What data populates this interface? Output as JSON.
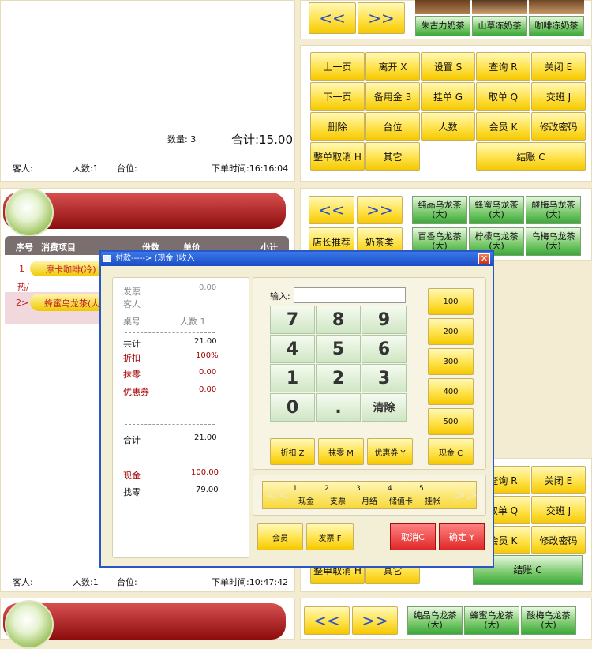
{
  "top_order": {
    "qty_label": "数量: 3",
    "total_label": "合计:15.00",
    "guest_label": "客人:",
    "people_label": "人数:1",
    "table_label": "台位:",
    "time_label": "下单时间:16:16:04"
  },
  "top_right": {
    "prev": "<<",
    "next": ">>",
    "items": [
      "朱古力奶茶",
      "山草冻奶茶",
      "咖啡冻奶茶"
    ]
  },
  "func_buttons": [
    "上一页",
    "离开 X",
    "设置 S",
    "查询 R",
    "关闭 E",
    "下一页",
    "备用金 3",
    "挂单 G",
    "取单 Q",
    "交班 J",
    "删除",
    "台位",
    "人数",
    "会员 K",
    "修改密码",
    "整单取消 H",
    "其它",
    "结账 C"
  ],
  "mid_right": {
    "prev": "<<",
    "next": ">>",
    "cat1": "店长推荐",
    "cat2": "奶茶类",
    "items": [
      "纯品乌龙茶(大)",
      "蜂蜜乌龙茶(大)",
      "酸梅乌龙茶(大)",
      "百香乌龙茶(大)",
      "柠檬乌龙茶(大)",
      "乌梅乌龙茶(大)"
    ]
  },
  "mid_order": {
    "headers": [
      "序号",
      "消费项目",
      "份数",
      "单价",
      "小计"
    ],
    "rows": [
      {
        "no": "1",
        "name": "摩卡咖啡(冷)",
        "note": "热/"
      },
      {
        "no": "2>",
        "name": "蜂蜜乌龙茶(大)"
      }
    ],
    "guest_label": "客人:",
    "people_label": "人数:1",
    "table_label": "台位:",
    "time_label": "下单时间:10:47:42"
  },
  "lower_right": {
    "btn1": "查询 R",
    "btn2": "关闭 E",
    "btn3": "取单 Q",
    "btn4": "交班 J",
    "btn5": "会员 K",
    "btn6": "修改密码",
    "btn7": "整单取消 H",
    "btn8": "其它",
    "btn9": "结账 C"
  },
  "bottom_right": {
    "prev": "<<",
    "next": ">>",
    "items": [
      "纯品乌龙茶(大)",
      "蜂蜜乌龙茶(大)",
      "酸梅乌龙茶(大)"
    ]
  },
  "dialog": {
    "title": "付款----->  (现金  )收入",
    "invoice_label": "发票",
    "invoice_value": "0.00",
    "guest_label": "客人",
    "table_label": "桌号",
    "people_label": "人数 1",
    "total_label": "共计",
    "total_value": "21.00",
    "discount_label": "折扣",
    "discount_value": "100%",
    "round_label": "抹零",
    "round_value": "0.00",
    "coupon_label": "优惠券",
    "coupon_value": "0.00",
    "sum_label": "合计",
    "sum_value": "21.00",
    "cash_label": "现金",
    "cash_value": "100.00",
    "change_label": "找零",
    "change_value": "79.00",
    "input_label": "输入:",
    "keys": [
      "7",
      "8",
      "9",
      "4",
      "5",
      "6",
      "1",
      "2",
      "3",
      "0",
      ".",
      "清除"
    ],
    "quick": [
      "100",
      "200",
      "300",
      "400",
      "500",
      "现金 C"
    ],
    "btn_discount": "折扣 Z",
    "btn_round": "抹零 M",
    "btn_coupon": "优惠券 Y",
    "pay_tabs": [
      {
        "num": "1",
        "label": "现金"
      },
      {
        "num": "2",
        "label": "支票"
      },
      {
        "num": "3",
        "label": "月结"
      },
      {
        "num": "4",
        "label": "储值卡"
      },
      {
        "num": "5",
        "label": "挂帐"
      }
    ],
    "btn_member": "会员",
    "btn_invoice": "发票 F",
    "btn_cancel": "取消C",
    "btn_ok": "确定 Y"
  }
}
